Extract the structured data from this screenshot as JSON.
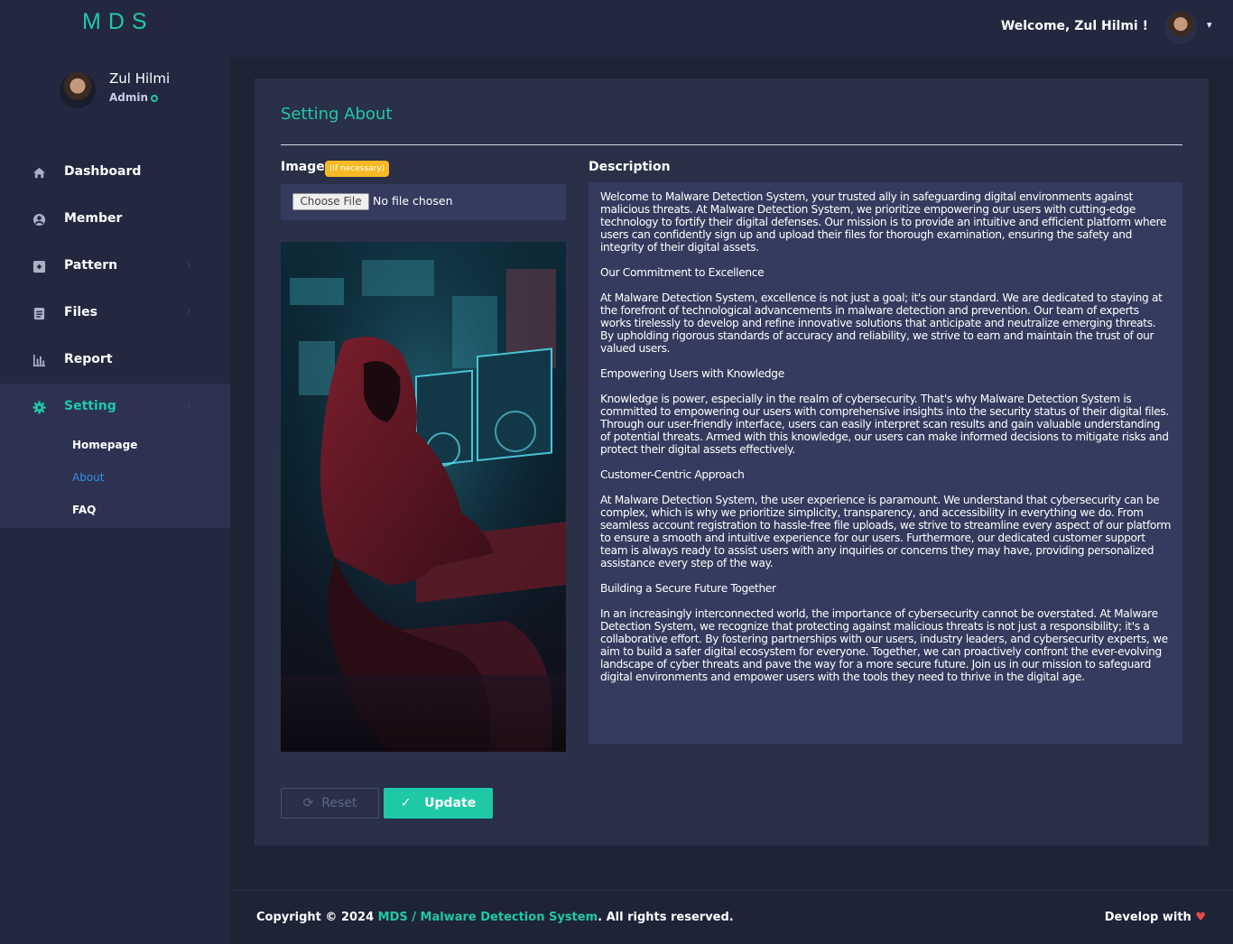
{
  "brand": "MDS",
  "topbar": {
    "welcome": "Welcome, Zul Hilmi !"
  },
  "profile": {
    "name": "Zul Hilmi",
    "role": "Admin"
  },
  "sidebar": {
    "items": [
      {
        "label": "Dashboard",
        "icon": "home-icon"
      },
      {
        "label": "Member",
        "icon": "user-circle-icon"
      },
      {
        "label": "Pattern",
        "icon": "pattern-icon"
      },
      {
        "label": "Files",
        "icon": "file-icon"
      },
      {
        "label": "Report",
        "icon": "bar-chart-icon"
      },
      {
        "label": "Setting",
        "icon": "gear-icon"
      }
    ],
    "submenu": [
      "Homepage",
      "About",
      "FAQ"
    ]
  },
  "card": {
    "title": "Setting About",
    "image_label": "Image",
    "image_badge": "(if necessary)",
    "choose_file": "Choose File",
    "no_file": "No file chosen",
    "description_label": "Description",
    "description": [
      "Welcome to Malware Detection System, your trusted ally in safeguarding digital environments against malicious threats. At Malware Detection System, we prioritize empowering our users with cutting-edge technology to fortify their digital defenses. Our mission is to provide an intuitive and efficient platform where users can confidently sign up and upload their files for thorough examination, ensuring the safety and integrity of their digital assets.",
      "Our Commitment to Excellence",
      "At Malware Detection System, excellence is not just a goal; it's our standard. We are dedicated to staying at the forefront of technological advancements in malware detection and prevention. Our team of experts works tirelessly to develop and refine innovative solutions that anticipate and neutralize emerging threats. By upholding rigorous standards of accuracy and reliability, we strive to earn and maintain the trust of our valued users.",
      "Empowering Users with Knowledge",
      "Knowledge is power, especially in the realm of cybersecurity. That's why Malware Detection System is committed to empowering our users with comprehensive insights into the security status of their digital files. Through our user-friendly interface, users can easily interpret scan results and gain valuable understanding of potential threats. Armed with this knowledge, our users can make informed decisions to mitigate risks and protect their digital assets effectively.",
      "Customer-Centric Approach",
      "At Malware Detection System, the user experience is paramount. We understand that cybersecurity can be complex, which is why we prioritize simplicity, transparency, and accessibility in everything we do. From seamless account registration to hassle-free file uploads, we strive to streamline every aspect of our platform to ensure a smooth and intuitive experience for our users. Furthermore, our dedicated customer support team is always ready to assist users with any inquiries or concerns they may have, providing personalized assistance every step of the way.",
      "Building a Secure Future Together",
      "In an increasingly interconnected world, the importance of cybersecurity cannot be overstated. At Malware Detection System, we recognize that protecting against malicious threats is not just a responsibility; it's a collaborative effort. By fostering partnerships with our users, industry leaders, and cybersecurity experts, we aim to build a safer digital ecosystem for everyone. Together, we can proactively confront the ever-evolving landscape of cyber threats and pave the way for a more secure future. Join us in our mission to safeguard digital environments and empower users with the tools they need to thrive in the digital age."
    ],
    "reset": "Reset",
    "update": "Update"
  },
  "footer": {
    "copyright_prefix": "Copyright © 2024 ",
    "copyright_link": "MDS / Malware Detection System",
    "copyright_suffix": ". All rights reserved.",
    "develop": "Develop with"
  },
  "colors": {
    "accent": "#1fc9a6",
    "badge": "#f7b924",
    "link": "#3b8edb",
    "heart": "#e5484d"
  }
}
